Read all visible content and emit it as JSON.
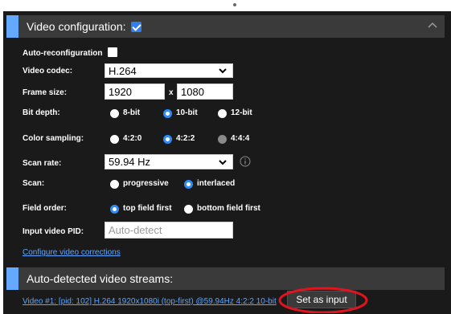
{
  "video_config": {
    "title": "Video configuration:",
    "enabled": true,
    "auto_reconfig_label": "Auto-reconfiguration",
    "auto_reconfig_checked": false,
    "codec_label": "Video codec:",
    "codec_value": "H.264",
    "frame_size_label": "Frame size:",
    "frame_width": "1920",
    "frame_sep": "x",
    "frame_height": "1080",
    "bit_depth_label": "Bit depth:",
    "bit_depth_options": [
      "8-bit",
      "10-bit",
      "12-bit"
    ],
    "bit_depth_selected": "10-bit",
    "color_sampling_label": "Color sampling:",
    "color_sampling_options": [
      "4:2:0",
      "4:2:2",
      "4:4:4"
    ],
    "color_sampling_selected": "4:2:2",
    "scan_rate_label": "Scan rate:",
    "scan_rate_value": "59.94 Hz",
    "scan_label": "Scan:",
    "scan_options": [
      "progressive",
      "interlaced"
    ],
    "scan_selected": "interlaced",
    "field_order_label": "Field order:",
    "field_order_options": [
      "top field first",
      "bottom field first"
    ],
    "field_order_selected": "top field first",
    "pid_label": "Input video PID:",
    "pid_placeholder": "Auto-detect",
    "configure_link": "Configure video corrections"
  },
  "auto_detected": {
    "title": "Auto-detected video streams:",
    "stream_link": "Video #1: [pid: 102] H.264 1920x1080i (top-first) @59.94Hz 4:2:2 10-bit",
    "set_input_label": "Set as input"
  },
  "colors": {
    "accent": "#64a9ff",
    "radio_selected": "#2f8cf5",
    "highlight": "#e0141e"
  }
}
